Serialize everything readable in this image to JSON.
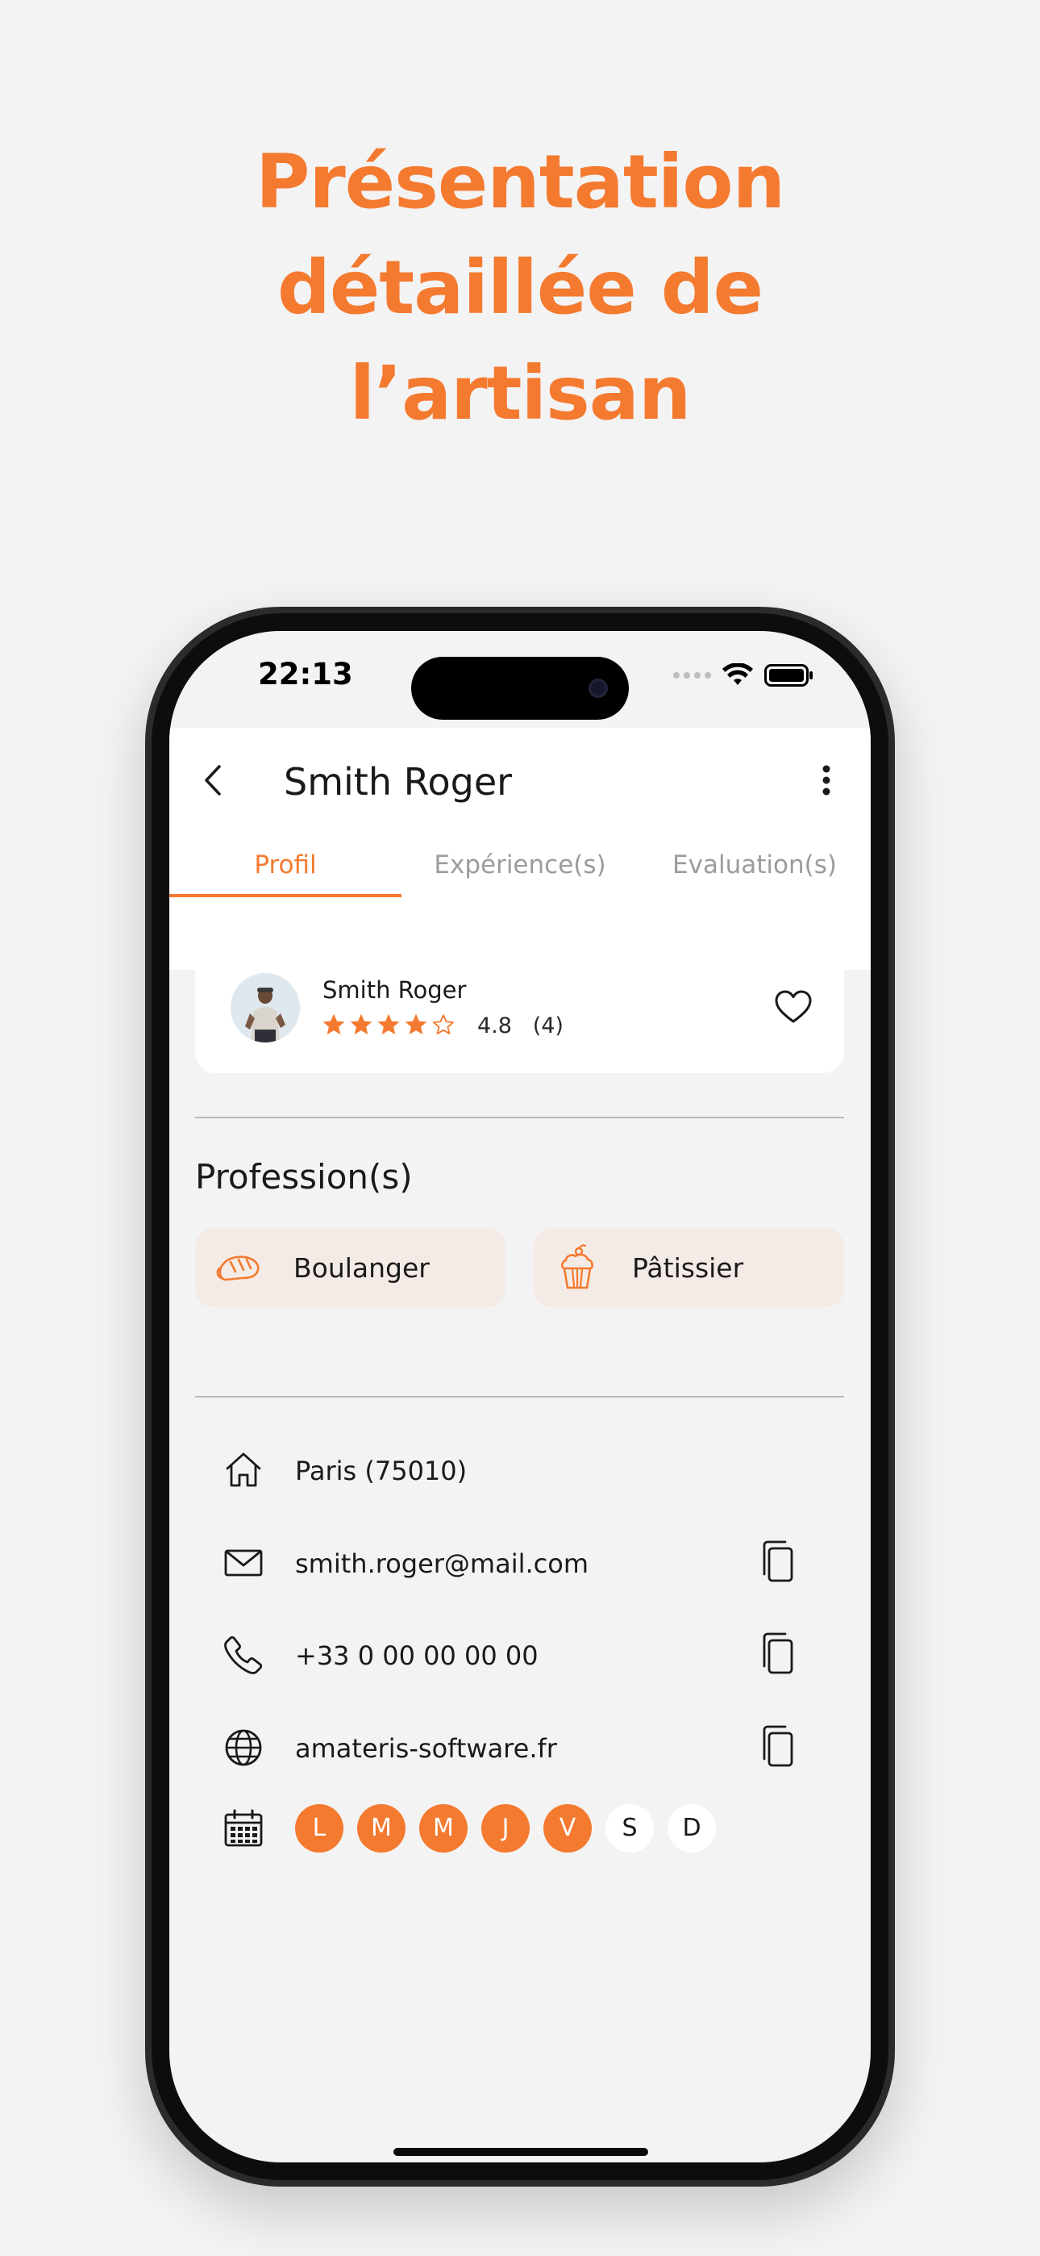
{
  "headline": {
    "line1": "Présentation",
    "line2": "détaillée de",
    "line3": "l’artisan"
  },
  "status_bar": {
    "time": "22:13"
  },
  "header": {
    "title": "Smith Roger"
  },
  "tabs": [
    {
      "label": "Profil",
      "active": true
    },
    {
      "label": "Expérience(s)",
      "active": false
    },
    {
      "label": "Evaluation(s)",
      "active": false
    }
  ],
  "profile": {
    "name": "Smith Roger",
    "rating": "4.8",
    "reviews": "(4)",
    "stars_filled": 4,
    "stars_total": 5
  },
  "professions": {
    "title": "Profession(s)",
    "items": [
      {
        "label": "Boulanger",
        "icon": "bread-icon"
      },
      {
        "label": "Pâtissier",
        "icon": "cupcake-icon"
      }
    ]
  },
  "contact": {
    "location": "Paris (75010)",
    "email": "smith.roger@mail.com",
    "phone": "+33 0 00 00 00 00",
    "website": "amateris-software.fr"
  },
  "availability": {
    "days": [
      {
        "label": "L",
        "active": true
      },
      {
        "label": "M",
        "active": true
      },
      {
        "label": "M",
        "active": true
      },
      {
        "label": "J",
        "active": true
      },
      {
        "label": "V",
        "active": true
      },
      {
        "label": "S",
        "active": false
      },
      {
        "label": "D",
        "active": false
      }
    ]
  },
  "colors": {
    "accent": "#f47a30",
    "pill_bg": "#f5ebe6",
    "background": "#f3f3f3"
  }
}
